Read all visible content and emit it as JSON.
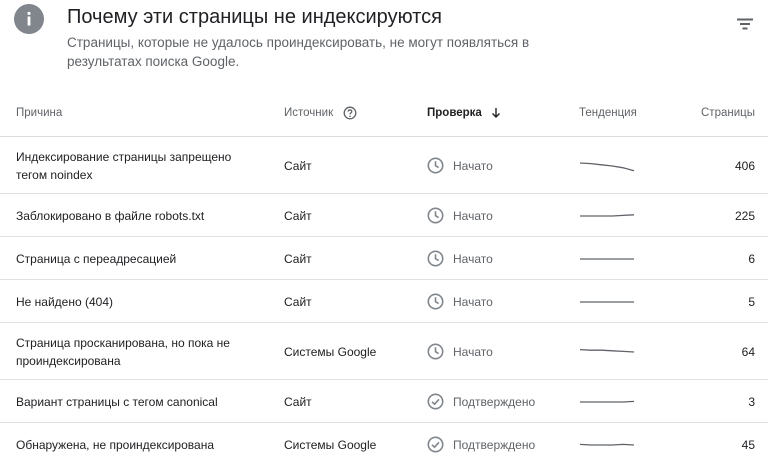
{
  "header": {
    "title": "Почему эти страницы не индексируются",
    "subtitle": "Страницы, которые не удалось проиндексировать, не могут появляться в результатах поиска Google.",
    "info_icon": "info-icon",
    "filter_icon": "filter-icon"
  },
  "table": {
    "columns": {
      "reason": "Причина",
      "source": "Источник",
      "check": "Проверка",
      "trend": "Тенденция",
      "pages": "Страницы"
    },
    "rows": [
      {
        "reason": "Индексирование страницы запрещено тегом noindex",
        "source": "Сайт",
        "status": "Начато",
        "status_icon": "clock-icon",
        "pages": "406",
        "trend": [
          0.25,
          0.3,
          0.4,
          0.5,
          0.65,
          0.9
        ]
      },
      {
        "reason": "Заблокировано в файле robots.txt",
        "source": "Сайт",
        "status": "Начато",
        "status_icon": "clock-icon",
        "pages": "225",
        "trend": [
          0.5,
          0.5,
          0.5,
          0.5,
          0.45,
          0.4
        ]
      },
      {
        "reason": "Страница с переадресацией",
        "source": "Сайт",
        "status": "Начато",
        "status_icon": "clock-icon",
        "pages": "6",
        "trend": [
          0.5,
          0.5,
          0.5,
          0.5,
          0.5,
          0.5
        ]
      },
      {
        "reason": "Не найдено (404)",
        "source": "Сайт",
        "status": "Начато",
        "status_icon": "clock-icon",
        "pages": "5",
        "trend": [
          0.5,
          0.5,
          0.5,
          0.5,
          0.5,
          0.5
        ]
      },
      {
        "reason": "Страница просканирована, но пока не проиндексирована",
        "source": "Системы Google",
        "status": "Начато",
        "status_icon": "clock-icon",
        "pages": "64",
        "trend": [
          0.3,
          0.35,
          0.35,
          0.4,
          0.45,
          0.5
        ]
      },
      {
        "reason": "Вариант страницы с тегом canonical",
        "source": "Сайт",
        "status": "Подтверждено",
        "status_icon": "check-circle-icon",
        "pages": "3",
        "trend": [
          0.5,
          0.5,
          0.5,
          0.5,
          0.5,
          0.45
        ]
      },
      {
        "reason": "Обнаружена, не проиндексирована",
        "source": "Системы Google",
        "status": "Подтверждено",
        "status_icon": "check-circle-icon",
        "pages": "45",
        "trend": [
          0.45,
          0.5,
          0.5,
          0.5,
          0.45,
          0.5
        ]
      }
    ]
  },
  "colors": {
    "text": "#202124",
    "muted": "#5f6368",
    "divider": "#e0e0e0",
    "icon": "#80868b",
    "spark": "#5f6368"
  }
}
